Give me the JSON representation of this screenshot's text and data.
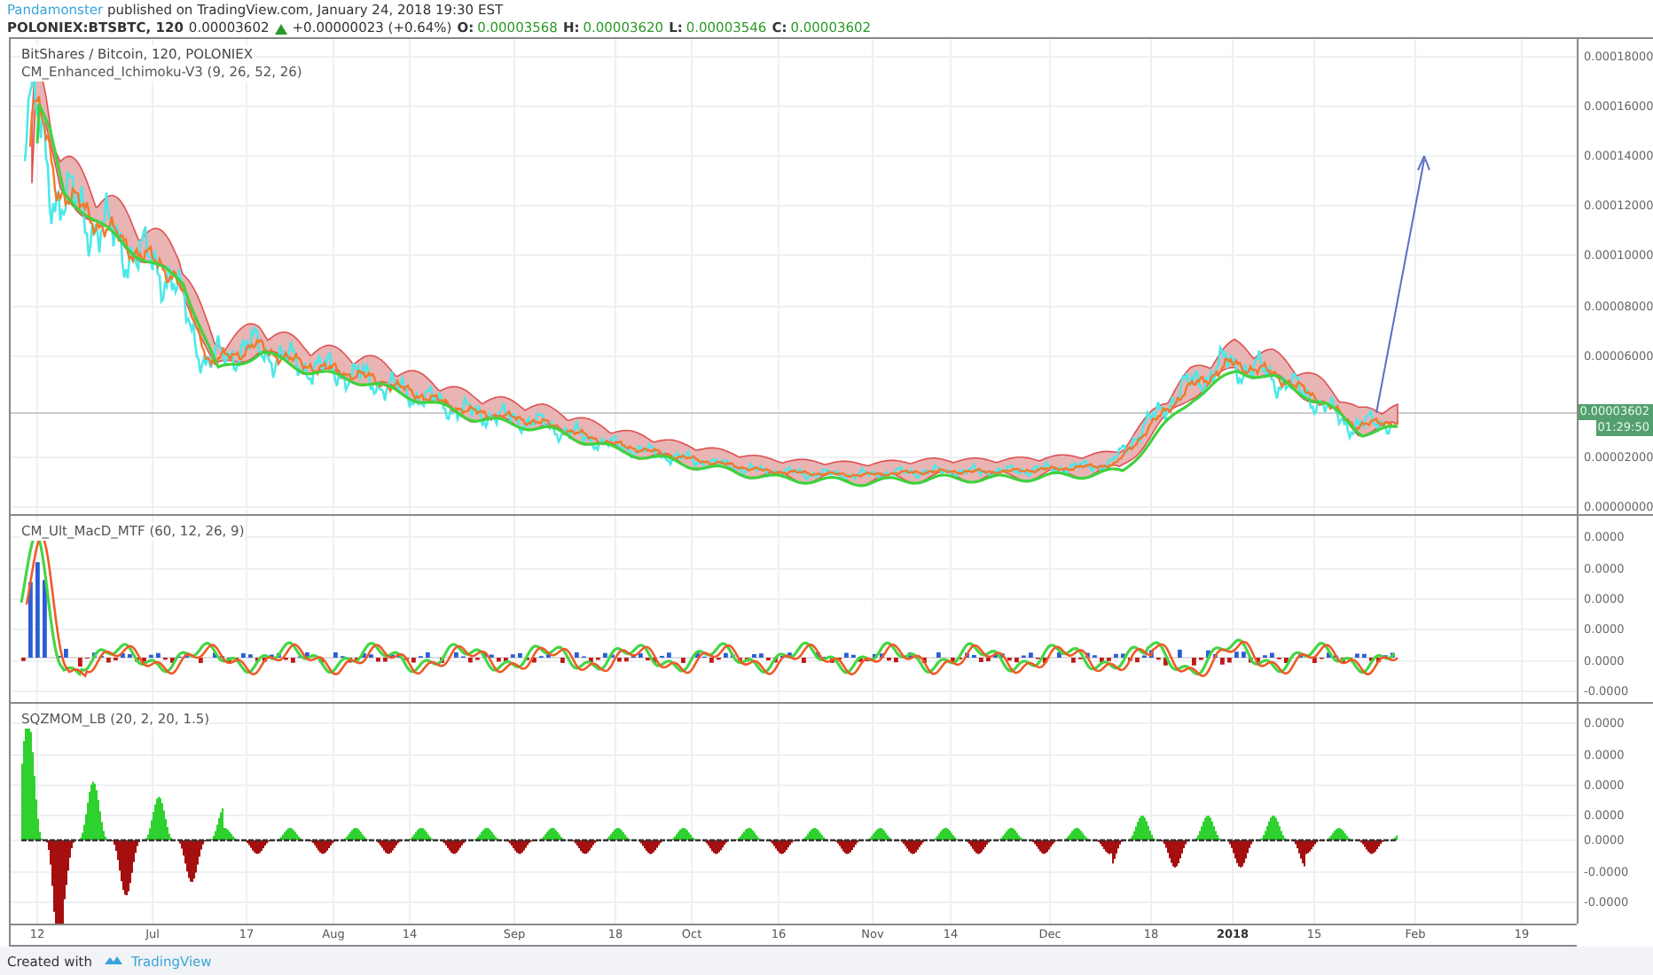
{
  "header": {
    "author": "Pandamonster",
    "published": "published on TradingView.com, January 24, 2018 19:30 EST"
  },
  "quote": {
    "symbol": "POLONIEX:BTSBTC, 120",
    "last": "0.00003602",
    "change": "+0.00000023 (+0.64%)",
    "ohlc": [
      {
        "label": "O:",
        "value": "0.00003568"
      },
      {
        "label": "H:",
        "value": "0.00003620"
      },
      {
        "label": "L:",
        "value": "0.00003546"
      },
      {
        "label": "C:",
        "value": "0.00003602"
      }
    ]
  },
  "panes": [
    {
      "kind": "price",
      "title": "BitShares / Bitcoin, 120, POLONIEX",
      "study": "CM_Enhanced_Ichimoku-V3 (9, 26, 52, 26)",
      "axis_labels": [
        "0.00018000",
        "0.00016000",
        "0.00014000",
        "0.00012000",
        "0.00010000",
        "0.00008000",
        "0.00006000",
        "0.00002000",
        "0.00000000"
      ],
      "price_tag": "0.00003602",
      "countdown": "01:29:50"
    },
    {
      "kind": "macd",
      "study": "CM_Ult_MacD_MTF (60, 12, 26, 9)",
      "axis_labels": [
        "0.0000",
        "0.0000",
        "0.0000",
        "0.0000",
        "0.0000",
        "-0.0000"
      ]
    },
    {
      "kind": "momentum",
      "study": "SQZMOM_LB (20, 2, 20, 1.5)",
      "axis_labels": [
        "0.0000",
        "0.0000",
        "0.0000",
        "0.0000",
        "0.0000",
        "-0.0000",
        "-0.0000"
      ]
    }
  ],
  "time_axis": [
    {
      "label": "12",
      "bold": false
    },
    {
      "label": "Jul",
      "bold": false
    },
    {
      "label": "17",
      "bold": false
    },
    {
      "label": "Aug",
      "bold": false
    },
    {
      "label": "14",
      "bold": false
    },
    {
      "label": "Sep",
      "bold": false
    },
    {
      "label": "18",
      "bold": false
    },
    {
      "label": "Oct",
      "bold": false
    },
    {
      "label": "16",
      "bold": false
    },
    {
      "label": "Nov",
      "bold": false
    },
    {
      "label": "14",
      "bold": false
    },
    {
      "label": "Dec",
      "bold": false
    },
    {
      "label": "18",
      "bold": false
    },
    {
      "label": "2018",
      "bold": true
    },
    {
      "label": "15",
      "bold": false
    },
    {
      "label": "Feb",
      "bold": false
    },
    {
      "label": "19",
      "bold": false
    }
  ],
  "footer": {
    "created": "Created with",
    "brand": "TradingView"
  }
}
